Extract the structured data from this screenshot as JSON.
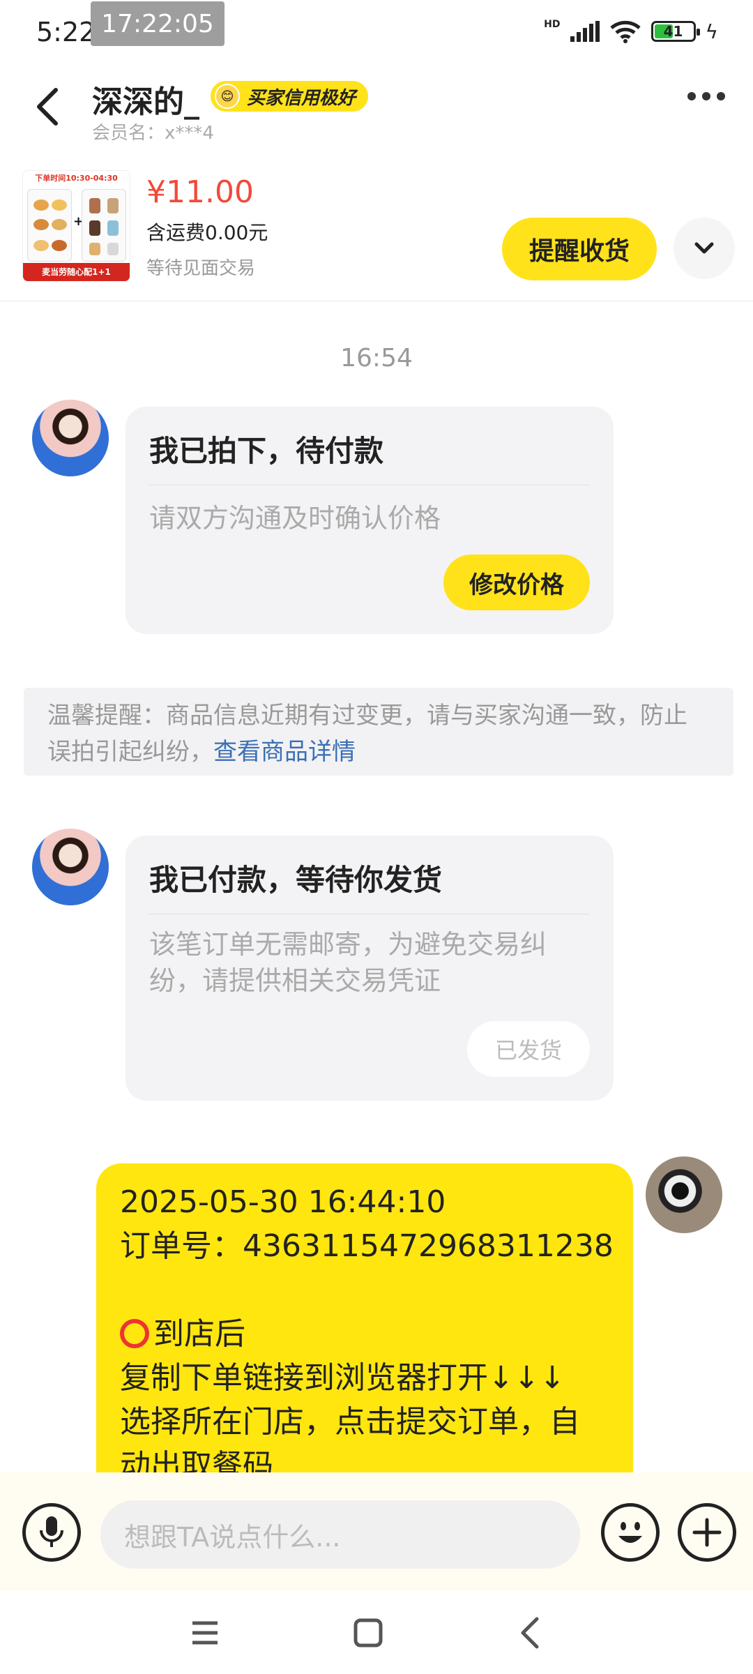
{
  "status_bar": {
    "time": "5:22",
    "overlay_time": "17:22:05",
    "network": "HD",
    "battery": "41"
  },
  "header": {
    "title": "深深的_",
    "badge": "买家信用极好",
    "member": "会员名：x***4"
  },
  "product": {
    "thumb_top": "下单时间10:30-04:30",
    "thumb_footer": "麦当劳随心配1+1",
    "price": "¥11.00",
    "shipping": "含运费0.00元",
    "status": "等待见面交易",
    "remind_button": "提醒收货"
  },
  "chat": {
    "timestamp": "16:54",
    "card1": {
      "title": "我已拍下，待付款",
      "desc": "请双方沟通及时确认价格",
      "button": "修改价格"
    },
    "notice": {
      "text": "温馨提醒：商品信息近期有过变更，请与买家沟通一致，防止误拍引起纠纷，",
      "link": "查看商品详情"
    },
    "card2": {
      "title": "我已付款，等待你发货",
      "desc": "该笔订单无需邮寄，为避免交易纠纷，请提供相关交易凭证",
      "button": "已发货"
    },
    "my_message": {
      "line1": "2025-05-30 16:44:10",
      "line2": "订单号：4363115472968311238",
      "line3": "到店后",
      "line4": "复制下单链接到浏览器打开↓↓↓",
      "line5": "选择所在门店，点击提交订单，自",
      "line6": "动出取餐码"
    }
  },
  "input": {
    "placeholder": "想跟TA说点什么..."
  },
  "colors": {
    "accent_yellow": "#ffe21a",
    "price_red": "#f24a3a",
    "link_blue": "#3b6fb6"
  }
}
